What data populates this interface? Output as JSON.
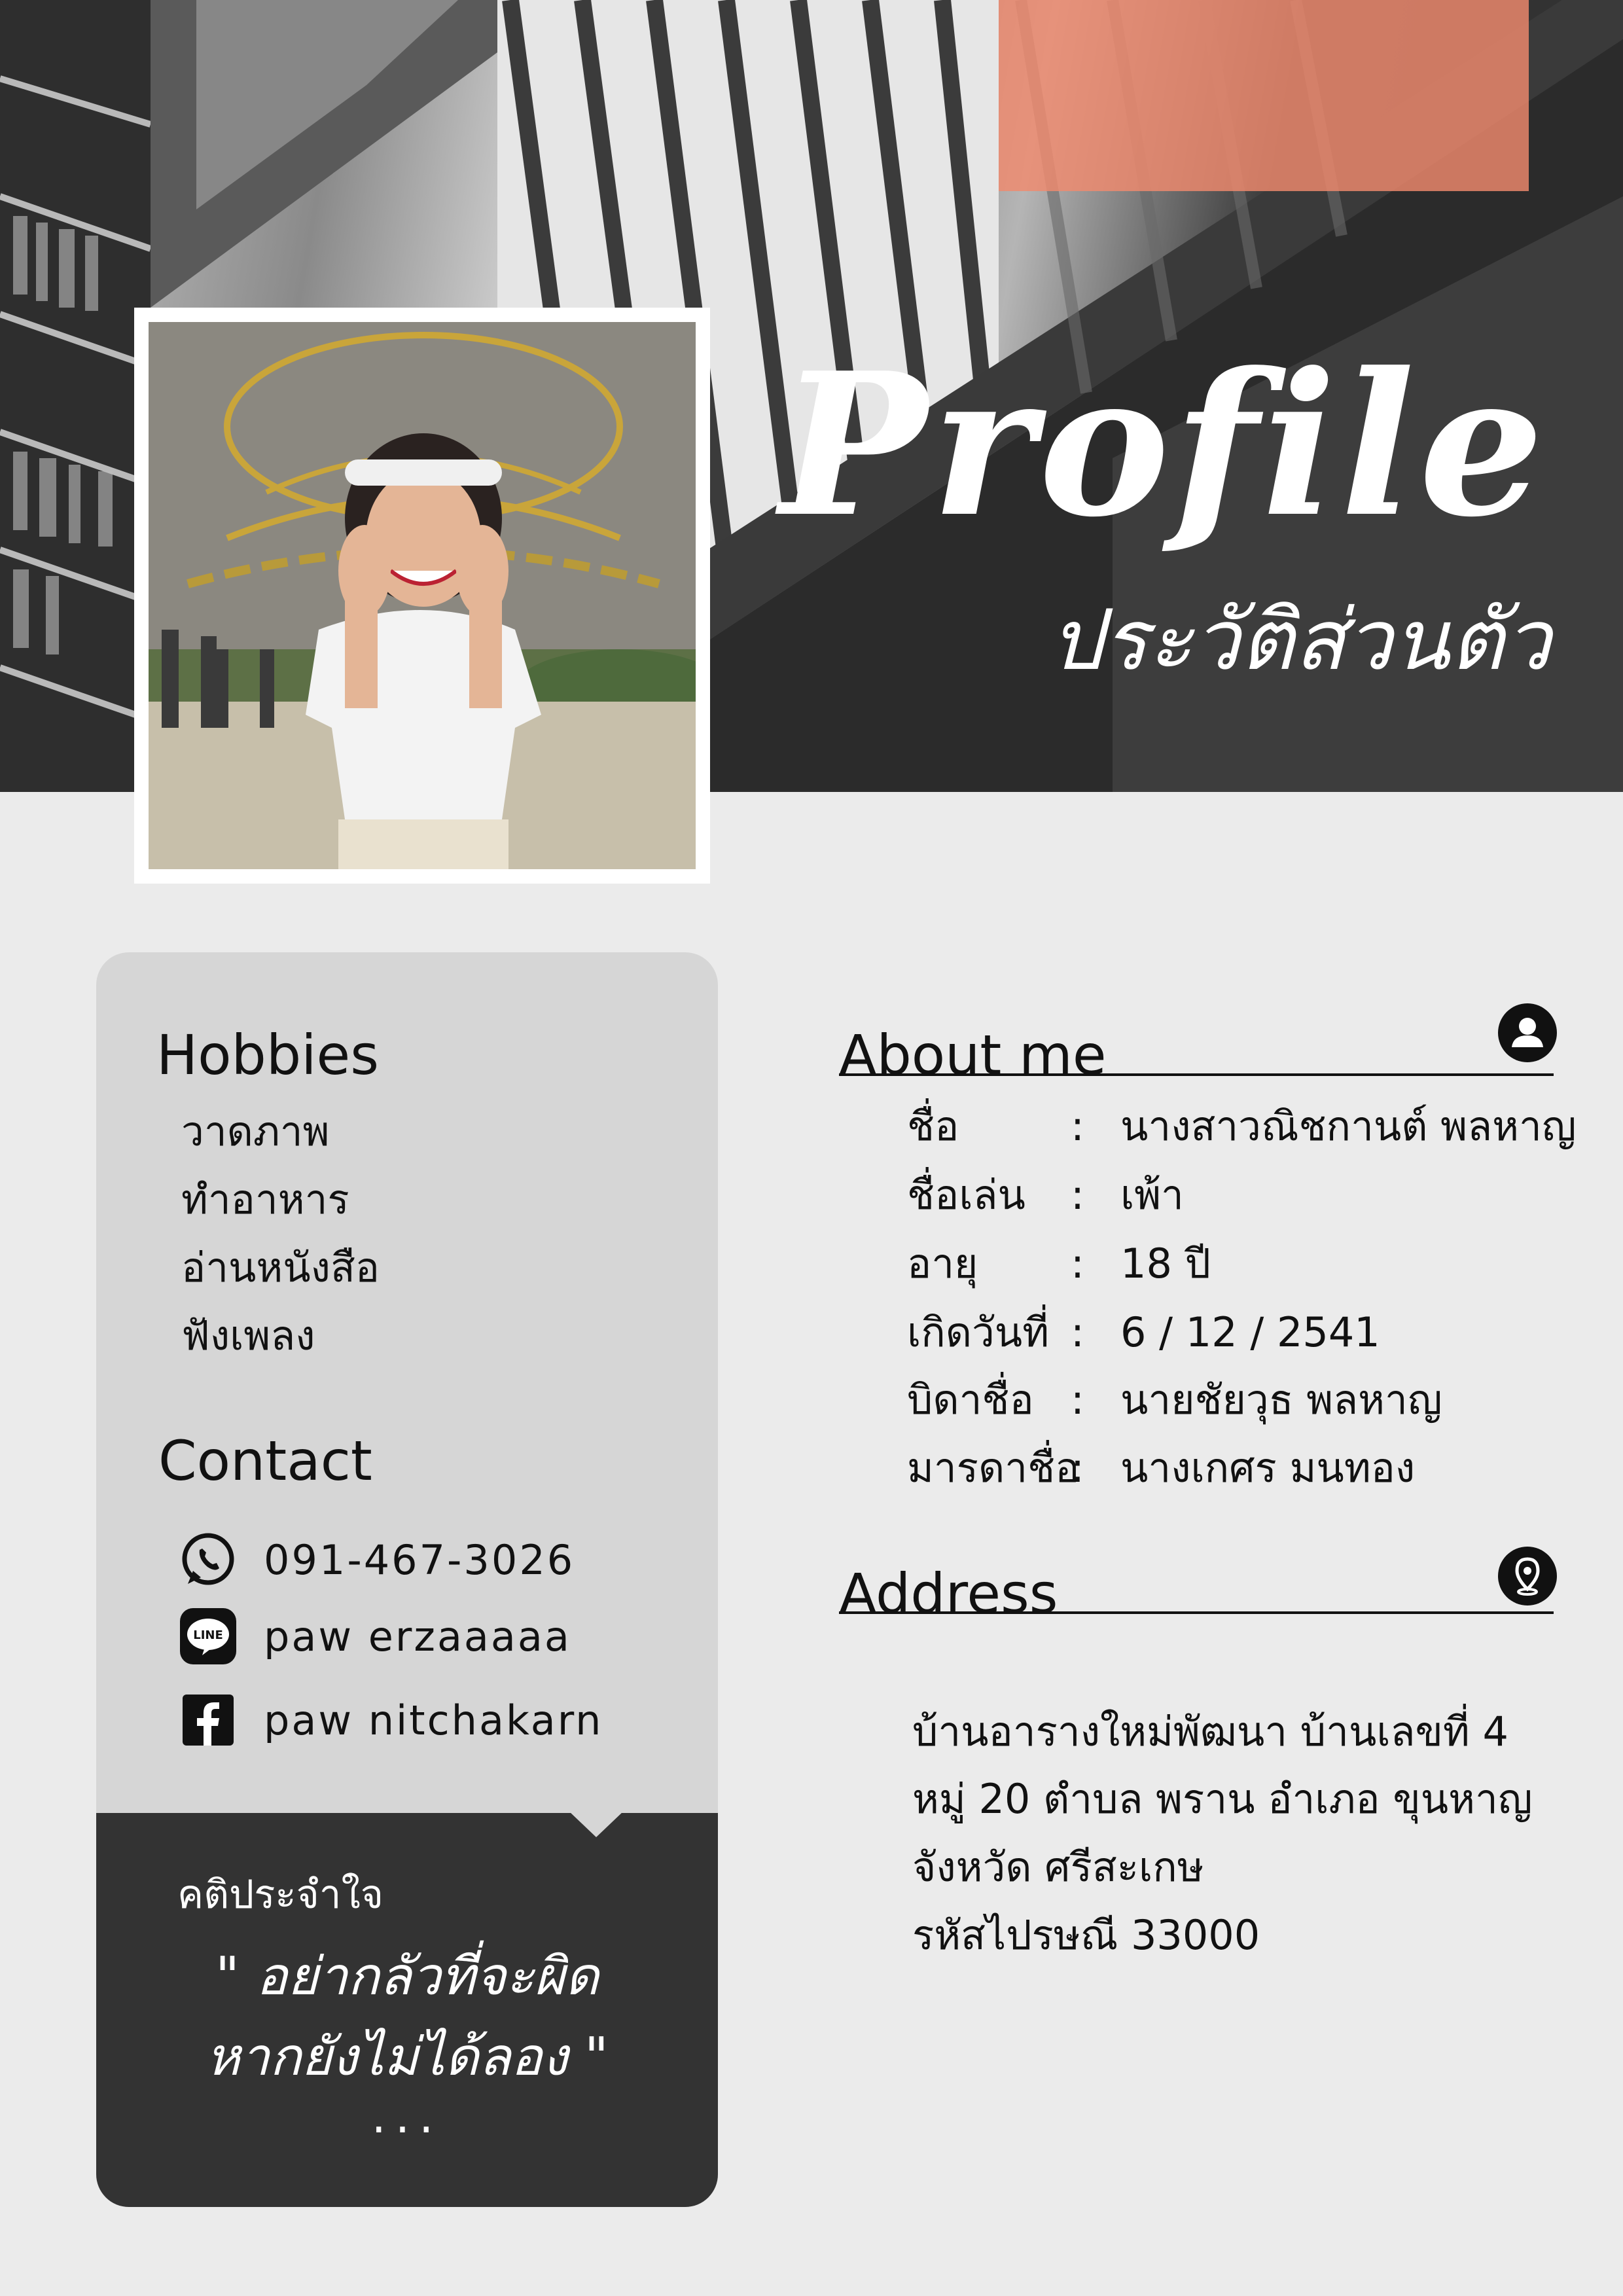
{
  "header": {
    "title": "Profile",
    "subtitle": "ประวัติส่วนตัว",
    "accent_color": "#f08a6e"
  },
  "hobbies": {
    "heading": "Hobbies",
    "items": [
      "วาดภาพ",
      "ทำอาหาร",
      "อ่านหนังสือ",
      "ฟังเพลง"
    ]
  },
  "contact": {
    "heading": "Contact",
    "items": [
      {
        "icon": "whatsapp-icon",
        "text": "091-467-3026"
      },
      {
        "icon": "line-icon",
        "text": "paw erzaaaaa"
      },
      {
        "icon": "facebook-icon",
        "text": "paw nitchakarn"
      }
    ]
  },
  "quote": {
    "label": "คติประจำใจ",
    "line1": "\" อย่ากลัวที่จะผิด",
    "line2": "หากยังไม่ได้ลอง \"",
    "dots": "..."
  },
  "about": {
    "heading": "About me",
    "icon": "user-icon",
    "rows": [
      {
        "label": "ชื่อ",
        "value": "นางสาวณิชกานต์ พลหาญ"
      },
      {
        "label": "ชื่อเล่น",
        "value": "เพ้า"
      },
      {
        "label": "อายุ",
        "value": "18 ปี"
      },
      {
        "label": "เกิดวันที่",
        "value": "6 / 12 / 2541"
      },
      {
        "label": "บิดาชื่อ",
        "value": "นายชัยวุธ  พลหาญ"
      },
      {
        "label": "มารดาชื่อ",
        "value": "นางเกศร  มนทอง"
      }
    ],
    "separator": ":"
  },
  "address": {
    "heading": "Address",
    "icon": "location-pin-icon",
    "lines": [
      "บ้านอารางใหม่พัฒนา  บ้านเลขที่ 4",
      "หมู่ 20  ตำบล พราน อำเภอ ขุนหาญ",
      "จังหวัด ศรีสะเกษ",
      "รหัสไปรษณี  33000"
    ]
  }
}
